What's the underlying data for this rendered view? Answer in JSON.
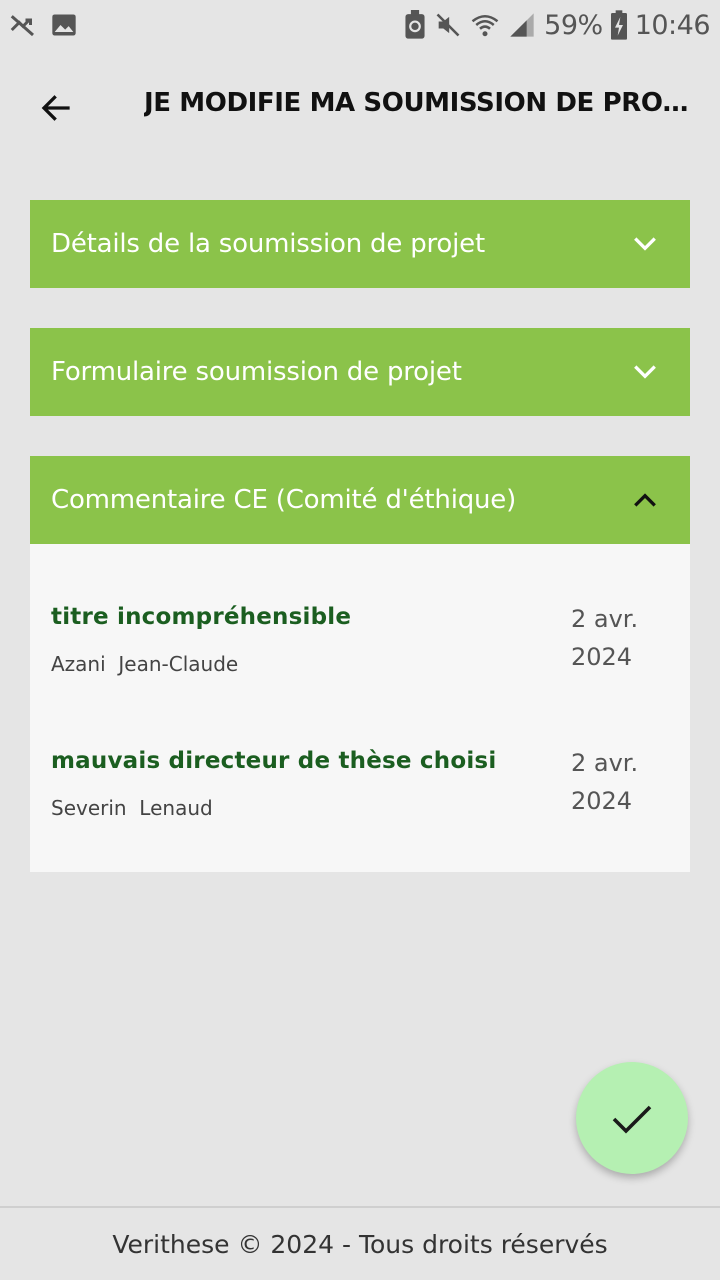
{
  "status_bar": {
    "left_icons": [
      "signal-off-icon",
      "image-icon"
    ],
    "right_icons": [
      "recycle-icon",
      "mute-icon",
      "wifi-icon",
      "cell-signal-icon",
      "battery-charging-icon"
    ],
    "battery": "59%",
    "time": "10:46"
  },
  "header": {
    "title": "JE MODIFIE MA SOUMISSION DE PROJ..."
  },
  "panels": [
    {
      "title": "Détails de la soumission de projet",
      "expanded": false
    },
    {
      "title": "Formulaire soumission de projet",
      "expanded": false
    },
    {
      "title": "Commentaire CE (Comité d'éthique)",
      "expanded": true
    }
  ],
  "comments": [
    {
      "title": "titre incompréhensible",
      "author": "Azani  Jean-Claude",
      "date_line1": "2 avr.",
      "date_line2": "2024"
    },
    {
      "title": "mauvais directeur de thèse choisi",
      "author": "Severin  Lenaud",
      "date_line1": "2 avr.",
      "date_line2": "2024"
    }
  ],
  "fab": {
    "icon": "check-icon"
  },
  "footer": {
    "text": "Verithese © 2024 - Tous droits réservés"
  },
  "colors": {
    "background": "#e5e5e5",
    "panel_header": "#8bc34a",
    "panel_body": "#f7f7f7",
    "comment_title": "#1b5e20",
    "fab": "#b5f0b2"
  }
}
